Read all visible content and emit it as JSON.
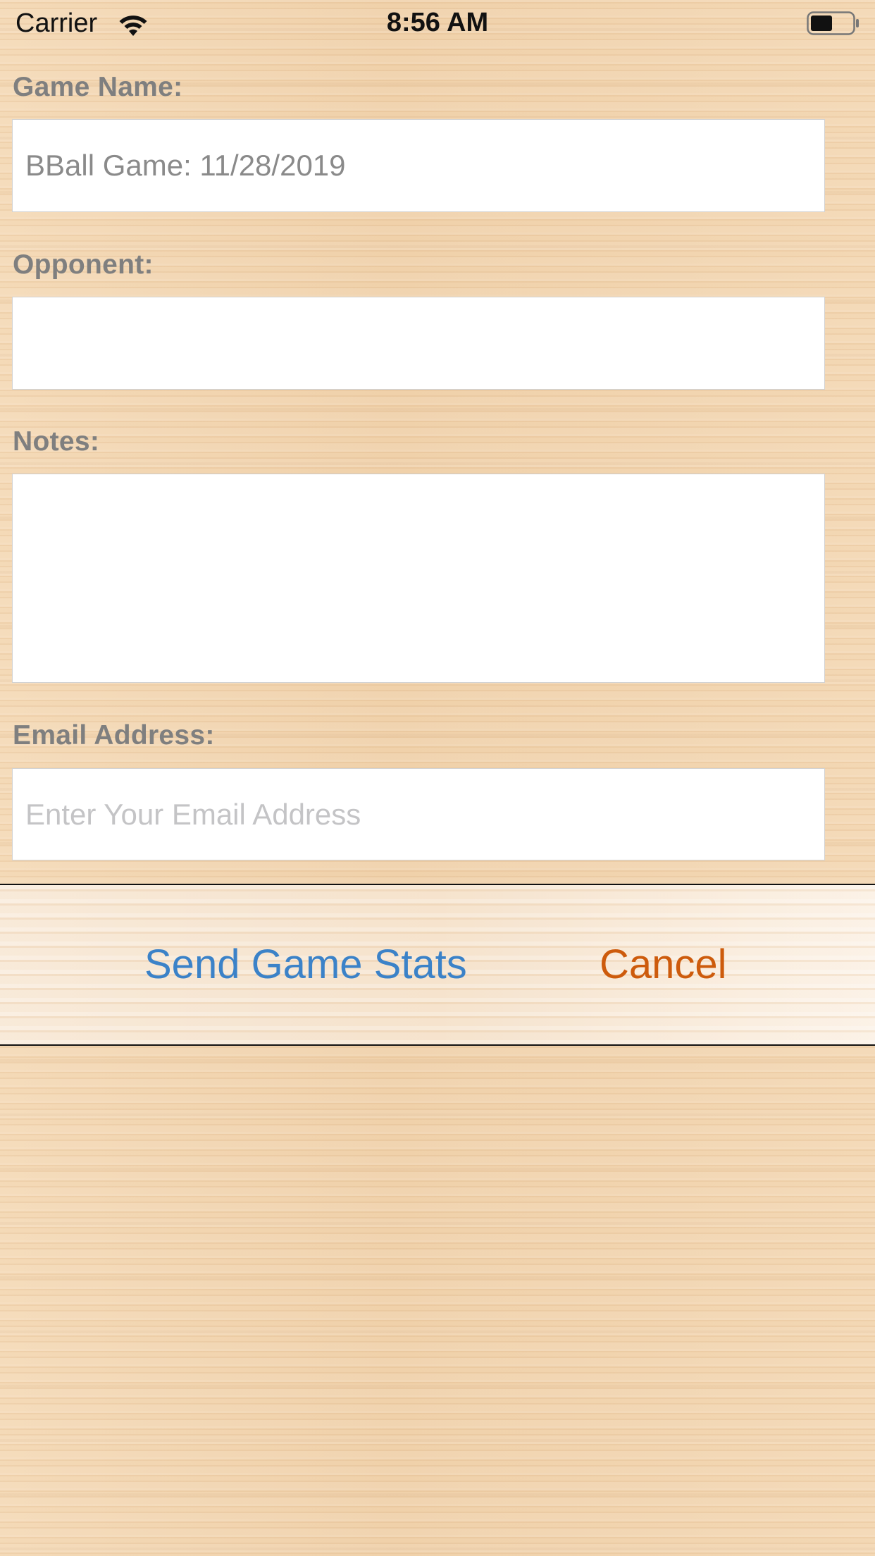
{
  "status_bar": {
    "carrier": "Carrier",
    "time": "8:56 AM",
    "icons": [
      "wifi-icon",
      "battery-icon"
    ]
  },
  "form": {
    "game_name": {
      "label": "Game Name:",
      "value": "BBall Game: 11/28/2019"
    },
    "opponent": {
      "label": "Opponent:",
      "value": ""
    },
    "notes": {
      "label": "Notes:",
      "value": ""
    },
    "email": {
      "label": "Email Address:",
      "value": "",
      "placeholder": "Enter Your Email Address"
    }
  },
  "actions": {
    "send_label": "Send Game Stats",
    "cancel_label": "Cancel"
  },
  "colors": {
    "label_gray": "#7f7f7f",
    "send_blue": "#3b82c8",
    "cancel_orange": "#cd5b0c",
    "wood_background": "#f1d3ae"
  }
}
